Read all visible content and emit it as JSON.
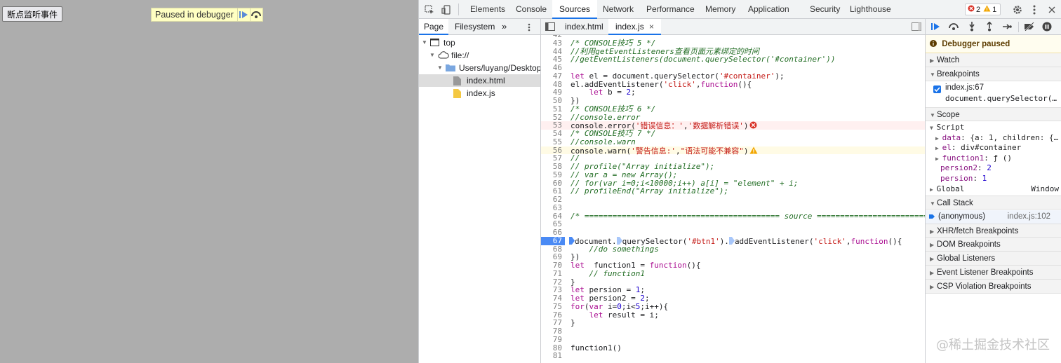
{
  "page": {
    "button_label": "断点监听事件",
    "banner_text": "Paused in debugger"
  },
  "devtools": {
    "tabs": [
      "Elements",
      "Console",
      "Sources",
      "Network",
      "Performance",
      "Memory",
      "Application",
      "Security",
      "Lighthouse"
    ],
    "active_tab": "Sources",
    "error_count": "2",
    "warning_count": "1"
  },
  "navigator": {
    "subtabs": [
      "Page",
      "Filesystem"
    ],
    "tree": [
      {
        "label": "top",
        "depth": 0,
        "icon": "frame-icon",
        "arrow": "▼"
      },
      {
        "label": "file://",
        "depth": 1,
        "icon": "cloud-icon",
        "arrow": "▼"
      },
      {
        "label": "Users/luyang/Desktop/6",
        "depth": 2,
        "icon": "folder-icon",
        "arrow": "▼"
      },
      {
        "label": "index.html",
        "depth": 3,
        "icon": "file-gray-icon",
        "arrow": "",
        "selected": true
      },
      {
        "label": "index.js",
        "depth": 3,
        "icon": "file-yellow-icon",
        "arrow": ""
      }
    ]
  },
  "editor": {
    "tabs": [
      "index.html",
      "index.js"
    ],
    "active_tab": "index.js",
    "lines": [
      {
        "n": "42",
        "html": ""
      },
      {
        "n": "43",
        "html": "<span class='cmt'>/* CONSOLE技巧 5 */</span>"
      },
      {
        "n": "44",
        "html": "<span class='cmt'>//利用getEventListeners查看页面元素绑定的时间</span>"
      },
      {
        "n": "45",
        "html": "<span class='cmt'>//getEventListeners(document.querySelector('#container'))</span>"
      },
      {
        "n": "46",
        "html": ""
      },
      {
        "n": "47",
        "html": "<span class='kw'>let</span> el = document.querySelector(<span class='str'>'#container'</span>);"
      },
      {
        "n": "48",
        "html": "el.addEventListener(<span class='str'>'click'</span>,<span class='kw'>function</span>(){"
      },
      {
        "n": "49",
        "html": "    <span class='kw'>let</span> b = <span class='num'>2</span>;"
      },
      {
        "n": "50",
        "html": "})"
      },
      {
        "n": "51",
        "html": "<span class='cmt'>/* CONSOLE技巧 6 */</span>"
      },
      {
        "n": "52",
        "html": "<span class='cmt'>//console.error</span>"
      },
      {
        "n": "53",
        "html": "console.error(<span class='str'>'错误信息：'</span>,<span class='str'>'数据解析错误'</span>)",
        "type": "error"
      },
      {
        "n": "54",
        "html": "<span class='cmt'>/* CONSOLE技巧 7 */</span>"
      },
      {
        "n": "55",
        "html": "<span class='cmt'>//console.warn</span>"
      },
      {
        "n": "56",
        "html": "console.warn(<span class='str'>'警告信息:'</span>,<span class='str'>\"语法可能不兼容\"</span>)",
        "type": "warn"
      },
      {
        "n": "57",
        "html": "<span class='cmt'>//</span>"
      },
      {
        "n": "58",
        "html": "<span class='cmt'>// profile(\"Array initialize\");</span>"
      },
      {
        "n": "59",
        "html": "<span class='cmt'>// var a = new Array();</span>"
      },
      {
        "n": "60",
        "html": "<span class='cmt'>// for(var i=0;i&lt;10000;i++) a[i] = \"element\" + i;</span>"
      },
      {
        "n": "61",
        "html": "<span class='cmt'>// profileEnd(\"Array initialize\");</span>"
      },
      {
        "n": "62",
        "html": ""
      },
      {
        "n": "63",
        "html": ""
      },
      {
        "n": "64",
        "html": "<span class='cmt'>/* ========================================== source ==========================</span>"
      },
      {
        "n": "65",
        "html": ""
      },
      {
        "n": "66",
        "html": ""
      },
      {
        "n": "67",
        "html": "document.querySelector(<span class='str'>'#btn1'</span>).addEventListener(<span class='str'>'click'</span>,<span class='kw'>function</span>(){",
        "type": "bp"
      },
      {
        "n": "68",
        "html": "    <span class='cmt'>//do somethings</span>"
      },
      {
        "n": "69",
        "html": "})"
      },
      {
        "n": "70",
        "html": "<span class='kw'>let</span>  function1 = <span class='kw'>function</span>(){"
      },
      {
        "n": "71",
        "html": "    <span class='cmt'>// function1</span>"
      },
      {
        "n": "72",
        "html": "}"
      },
      {
        "n": "73",
        "html": "<span class='kw'>let</span> persion = <span class='num'>1</span>;"
      },
      {
        "n": "74",
        "html": "<span class='kw'>let</span> persion2 = <span class='num'>2</span>;"
      },
      {
        "n": "75",
        "html": "<span class='kw'>for</span>(<span class='kw'>var</span> i=<span class='num'>0</span>;i&lt;<span class='num'>5</span>;i++){"
      },
      {
        "n": "76",
        "html": "    <span class='kw'>let</span> result = i;"
      },
      {
        "n": "77",
        "html": "}"
      },
      {
        "n": "78",
        "html": ""
      },
      {
        "n": "79",
        "html": ""
      },
      {
        "n": "80",
        "html": "function1()"
      },
      {
        "n": "81",
        "html": ""
      }
    ]
  },
  "debugger": {
    "paused_label": "Debugger paused",
    "sections": {
      "watch": "Watch",
      "breakpoints": "Breakpoints",
      "scope": "Scope",
      "callstack": "Call Stack",
      "xhr": "XHR/fetch Breakpoints",
      "dom": "DOM Breakpoints",
      "global_listeners": "Global Listeners",
      "event_listener": "Event Listener Breakpoints",
      "csp": "CSP Violation Breakpoints"
    },
    "breakpoint": {
      "file": "index.js:67",
      "code": "document.querySelector(…"
    },
    "scope": {
      "script_label": "Script",
      "rows": [
        {
          "key": "data",
          "value": "{a: 1, children: {…",
          "expand": true
        },
        {
          "key": "el",
          "value": "div#container",
          "expand": true
        },
        {
          "key": "function1",
          "value": "ƒ ()",
          "expand": true
        },
        {
          "key": "persion2",
          "value": "2",
          "expand": false
        },
        {
          "key": "persion",
          "value": "1",
          "expand": false
        }
      ],
      "global_label": "Global",
      "global_value": "Window"
    },
    "callstack": {
      "frame": "(anonymous)",
      "location": "index.js:102"
    }
  },
  "watermark": "@稀土掘金技术社区"
}
